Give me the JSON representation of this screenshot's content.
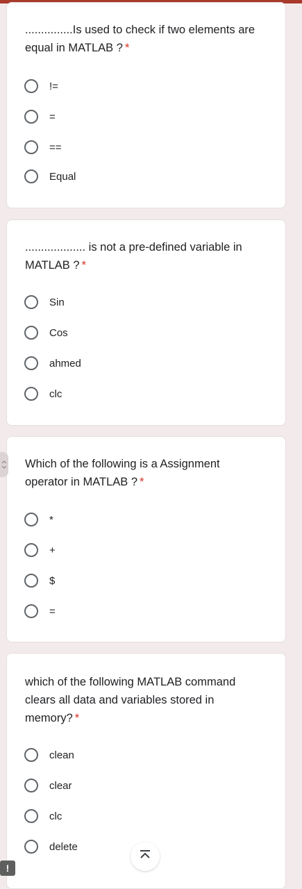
{
  "questions": [
    {
      "title": "...............Is used to check if two elements are equal in MATLAB ?",
      "required": "*",
      "options": [
        "!=",
        "=",
        "==",
        "Equal"
      ]
    },
    {
      "title": "................... is not a pre-defined variable in MATLAB ?",
      "required": "*",
      "options": [
        "Sin",
        "Cos",
        "ahmed",
        "clc"
      ]
    },
    {
      "title": "Which of the following is a Assignment operator in MATLAB ?",
      "required": "*",
      "options": [
        "*",
        "+",
        "$",
        "="
      ]
    },
    {
      "title": "which of the following MATLAB command clears all data and variables stored in memory?",
      "required": "*",
      "options": [
        "clean",
        "clear",
        "clc",
        "delete"
      ]
    }
  ],
  "icons": {
    "side_handle": "chevron-up-down-icon",
    "feedback": "exclamation-icon",
    "scroll_top": "arrow-to-top-icon"
  },
  "feedback_glyph": "!",
  "colors": {
    "accent": "#a93a2b",
    "required": "#d93025",
    "background": "#f3ebeb"
  }
}
